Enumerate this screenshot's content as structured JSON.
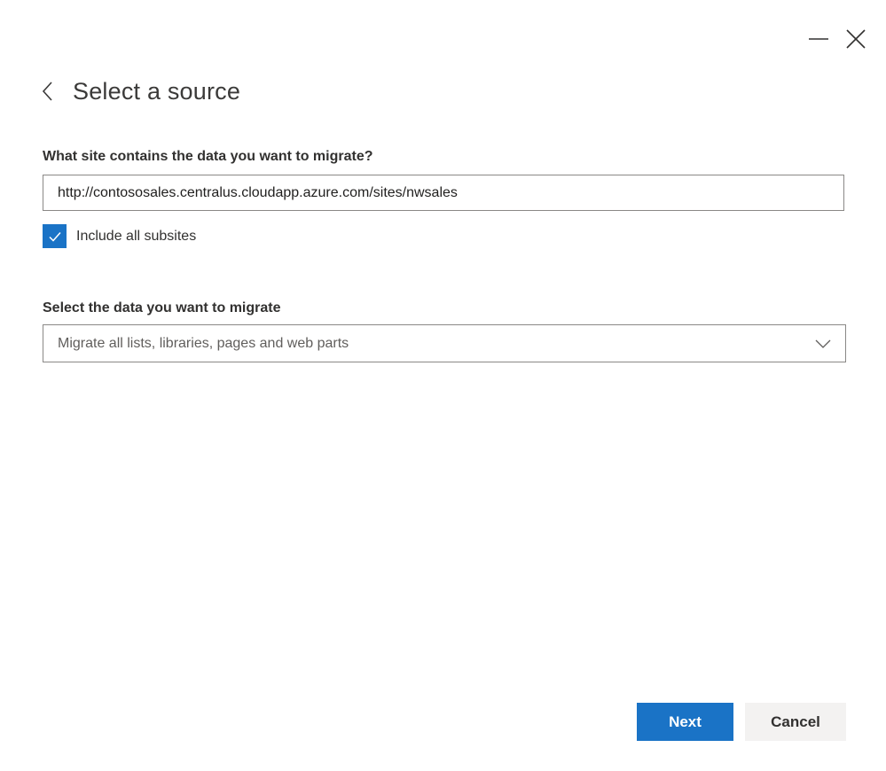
{
  "window": {
    "controls": {
      "minimize_icon": "minimize-icon",
      "close_icon": "close-icon"
    }
  },
  "header": {
    "back_icon": "chevron-left-icon",
    "title": "Select a source"
  },
  "site_field": {
    "label": "What site contains the data you want to migrate?",
    "value": "http://contososales.centralus.cloudapp.azure.com/sites/nwsales"
  },
  "subsites_checkbox": {
    "label": "Include all subsites",
    "checked": true
  },
  "data_select": {
    "label": "Select the data you want to migrate",
    "selected": "Migrate all lists, libraries, pages and web parts",
    "icon": "chevron-down-icon"
  },
  "actions": {
    "next_label": "Next",
    "cancel_label": "Cancel"
  },
  "colors": {
    "accent": "#1a73c6",
    "secondary_button": "#f3f2f1",
    "border": "#8a8886",
    "text": "#323130"
  }
}
